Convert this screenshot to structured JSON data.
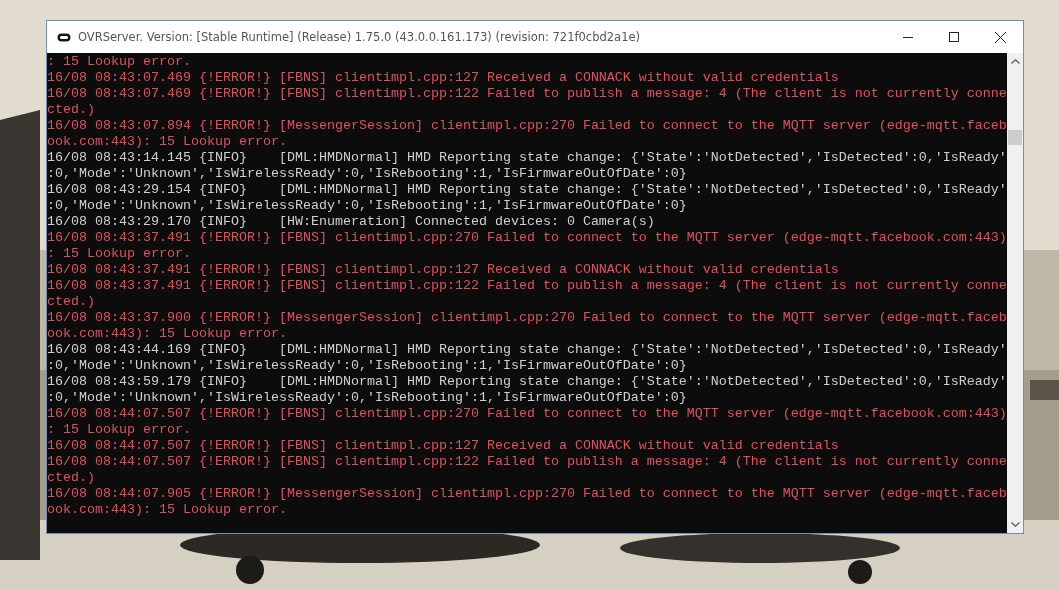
{
  "window": {
    "title": "OVRServer. Version: [Stable Runtime] (Release) 1.75.0 (43.0.0.161.173) (revision: 721f0cbd2a1e)"
  },
  "console": {
    "lines": [
      {
        "kind": "error",
        "text": ": 15 Lookup error."
      },
      {
        "kind": "error",
        "text": "16/08 08:43:07.469 {!ERROR!} [FBNS] clientimpl.cpp:127 Received a CONNACK without valid credentials"
      },
      {
        "kind": "error",
        "text": "16/08 08:43:07.469 {!ERROR!} [FBNS] clientimpl.cpp:122 Failed to publish a message: 4 (The client is not currently conne"
      },
      {
        "kind": "error",
        "text": "cted.)"
      },
      {
        "kind": "error",
        "text": "16/08 08:43:07.894 {!ERROR!} [MessengerSession] clientimpl.cpp:270 Failed to connect to the MQTT server (edge-mqtt.faceb"
      },
      {
        "kind": "error",
        "text": "ook.com:443): 15 Lookup error."
      },
      {
        "kind": "info",
        "text": "16/08 08:43:14.145 {INFO}    [DML:HMDNormal] HMD Reporting state change: {'State':'NotDetected','IsDetected':0,'IsReady'"
      },
      {
        "kind": "info",
        "text": ":0,'Mode':'Unknown','IsWirelessReady':0,'IsRebooting':1,'IsFirmwareOutOfDate':0}"
      },
      {
        "kind": "info",
        "text": "16/08 08:43:29.154 {INFO}    [DML:HMDNormal] HMD Reporting state change: {'State':'NotDetected','IsDetected':0,'IsReady'"
      },
      {
        "kind": "info",
        "text": ":0,'Mode':'Unknown','IsWirelessReady':0,'IsRebooting':1,'IsFirmwareOutOfDate':0}"
      },
      {
        "kind": "info",
        "text": "16/08 08:43:29.170 {INFO}    [HW:Enumeration] Connected devices: 0 Camera(s)"
      },
      {
        "kind": "error",
        "text": "16/08 08:43:37.491 {!ERROR!} [FBNS] clientimpl.cpp:270 Failed to connect to the MQTT server (edge-mqtt.facebook.com:443)"
      },
      {
        "kind": "error",
        "text": ": 15 Lookup error."
      },
      {
        "kind": "error",
        "text": "16/08 08:43:37.491 {!ERROR!} [FBNS] clientimpl.cpp:127 Received a CONNACK without valid credentials"
      },
      {
        "kind": "error",
        "text": "16/08 08:43:37.491 {!ERROR!} [FBNS] clientimpl.cpp:122 Failed to publish a message: 4 (The client is not currently conne"
      },
      {
        "kind": "error",
        "text": "cted.)"
      },
      {
        "kind": "error",
        "text": "16/08 08:43:37.900 {!ERROR!} [MessengerSession] clientimpl.cpp:270 Failed to connect to the MQTT server (edge-mqtt.faceb"
      },
      {
        "kind": "error",
        "text": "ook.com:443): 15 Lookup error."
      },
      {
        "kind": "info",
        "text": "16/08 08:43:44.169 {INFO}    [DML:HMDNormal] HMD Reporting state change: {'State':'NotDetected','IsDetected':0,'IsReady'"
      },
      {
        "kind": "info",
        "text": ":0,'Mode':'Unknown','IsWirelessReady':0,'IsRebooting':1,'IsFirmwareOutOfDate':0}"
      },
      {
        "kind": "info",
        "text": "16/08 08:43:59.179 {INFO}    [DML:HMDNormal] HMD Reporting state change: {'State':'NotDetected','IsDetected':0,'IsReady'"
      },
      {
        "kind": "info",
        "text": ":0,'Mode':'Unknown','IsWirelessReady':0,'IsRebooting':1,'IsFirmwareOutOfDate':0}"
      },
      {
        "kind": "error",
        "text": "16/08 08:44:07.507 {!ERROR!} [FBNS] clientimpl.cpp:270 Failed to connect to the MQTT server (edge-mqtt.facebook.com:443)"
      },
      {
        "kind": "error",
        "text": ": 15 Lookup error."
      },
      {
        "kind": "error",
        "text": "16/08 08:44:07.507 {!ERROR!} [FBNS] clientimpl.cpp:127 Received a CONNACK without valid credentials"
      },
      {
        "kind": "error",
        "text": "16/08 08:44:07.507 {!ERROR!} [FBNS] clientimpl.cpp:122 Failed to publish a message: 4 (The client is not currently conne"
      },
      {
        "kind": "error",
        "text": "cted.)"
      },
      {
        "kind": "error",
        "text": "16/08 08:44:07.905 {!ERROR!} [MessengerSession] clientimpl.cpp:270 Failed to connect to the MQTT server (edge-mqtt.faceb"
      },
      {
        "kind": "error",
        "text": "ook.com:443): 15 Lookup error."
      }
    ]
  }
}
